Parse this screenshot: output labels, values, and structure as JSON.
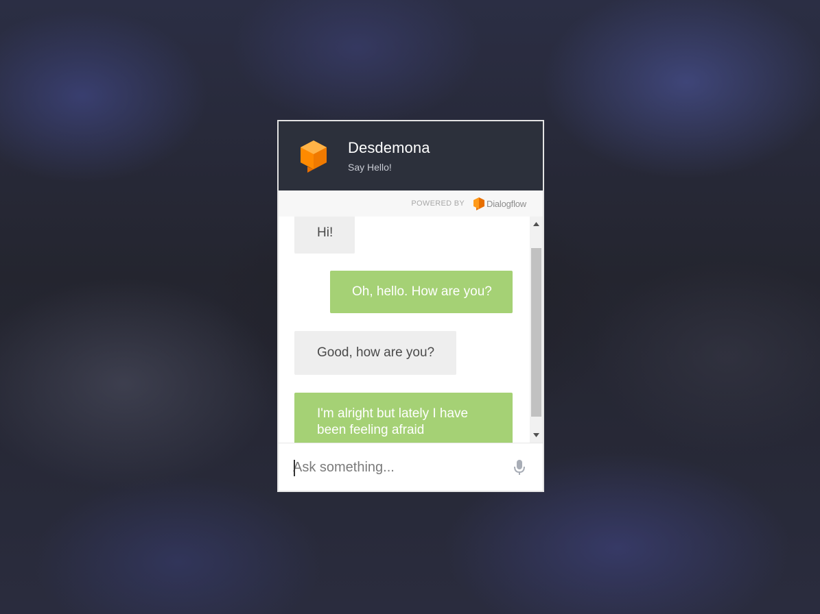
{
  "header": {
    "agent_name": "Desdemona",
    "tagline": "Say Hello!",
    "avatar_icon": "dialogflow-agent-icon",
    "accent_color": "#ff8a00"
  },
  "powered_by": {
    "label": "POWERED BY",
    "brand": "Dialogflow",
    "brand_icon": "dialogflow-logo-icon"
  },
  "messages": [
    {
      "from": "agent",
      "text": "Hi!"
    },
    {
      "from": "user",
      "text": "Oh, hello. How are you?"
    },
    {
      "from": "agent",
      "text": "Good, how are you?"
    },
    {
      "from": "user",
      "text": "I'm alright but lately I have been feeling afraid"
    }
  ],
  "input": {
    "placeholder": "Ask something...",
    "value": "",
    "mic_icon": "microphone-icon"
  },
  "colors": {
    "header_bg": "#2c303b",
    "agent_bubble": "#eeeeee",
    "user_bubble": "#a5d175"
  }
}
